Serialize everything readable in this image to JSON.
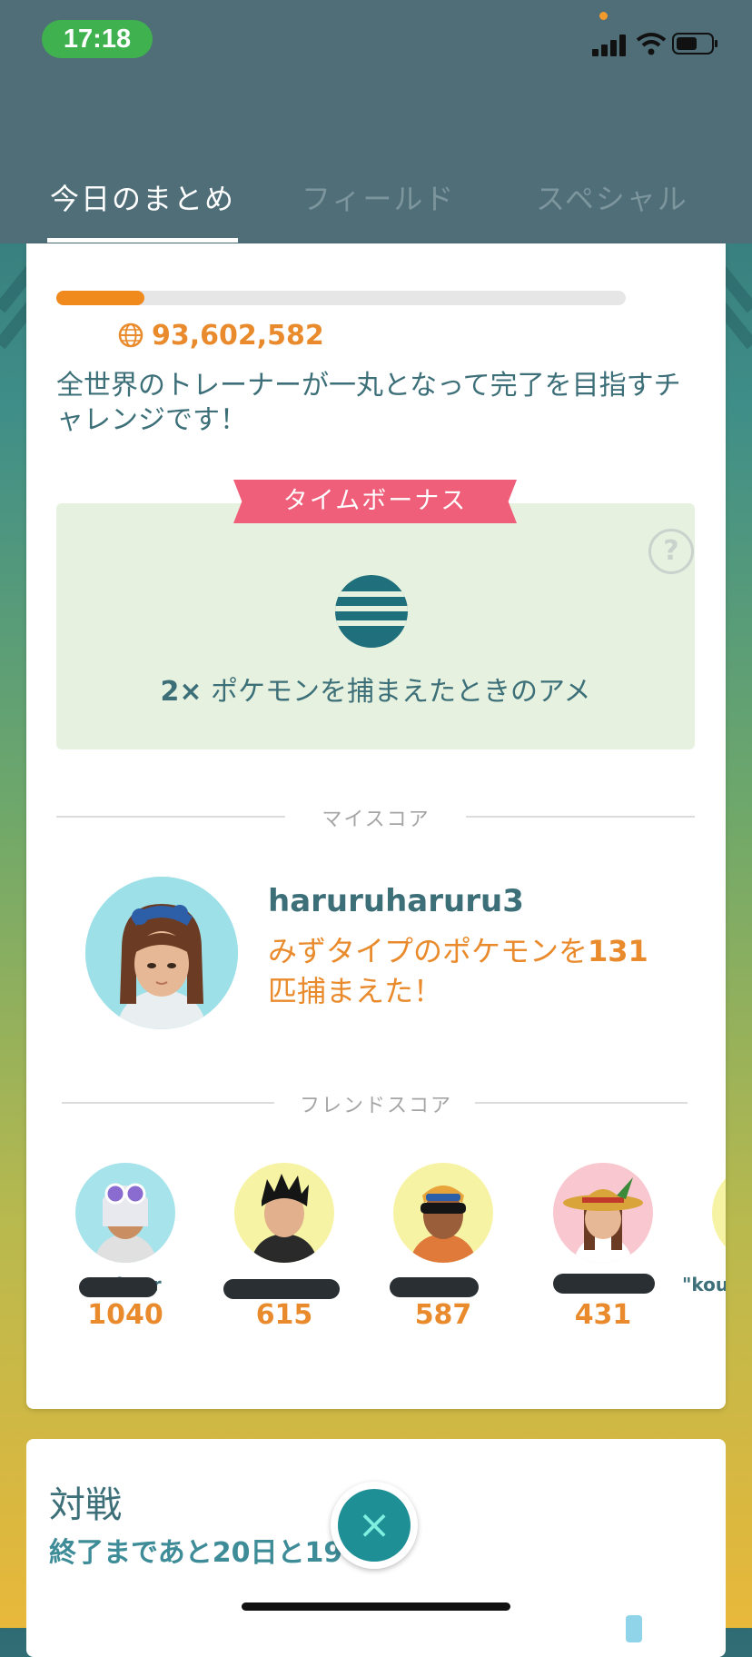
{
  "status_bar": {
    "time": "17:18"
  },
  "tabs": [
    {
      "label": "今日のまとめ",
      "active": true
    },
    {
      "label": "フィールド",
      "active": false
    },
    {
      "label": "スペシャル",
      "active": false
    }
  ],
  "challenge": {
    "progress_fraction": 0.155,
    "global_count": "93,602,582",
    "description": "全世界のトレーナーが一丸となって完了を目指すチャレンジです！"
  },
  "time_bonus": {
    "ribbon_label": "タイムボーナス",
    "help_icon": "?",
    "multiplier": "2×",
    "text": " ポケモンを捕まえたときのアメ"
  },
  "my_score": {
    "section_label": "マイスコア",
    "username": "haruruharuru3",
    "achievement_prefix": "みずタイプのポケモンを",
    "achievement_count": "131",
    "achievement_suffix": "匹捕まえた！"
  },
  "friend_score": {
    "section_label": "フレンドスコア",
    "friends": [
      {
        "name": "Twitter",
        "score": "1040",
        "color": "#a7e3ea"
      },
      {
        "name": "",
        "score": "615",
        "color": "#f7f3a5"
      },
      {
        "name": "",
        "score": "587",
        "color": "#f7f3a5"
      },
      {
        "name": "",
        "score": "431",
        "color": "#f9c7cf"
      },
      {
        "name": "\"kout",
        "score": "",
        "color": "#f7f3a5"
      }
    ]
  },
  "battle": {
    "title": "対戦",
    "subtitle": "終了まであと20日と19"
  },
  "icons": {
    "globe": "globe-icon",
    "candy": "candy-icon",
    "close": "×"
  },
  "colors": {
    "accent_orange": "#e98b2c",
    "teal_text": "#3d6f79",
    "ribbon_pink": "#ef5f79",
    "header": "#4f6e78"
  }
}
